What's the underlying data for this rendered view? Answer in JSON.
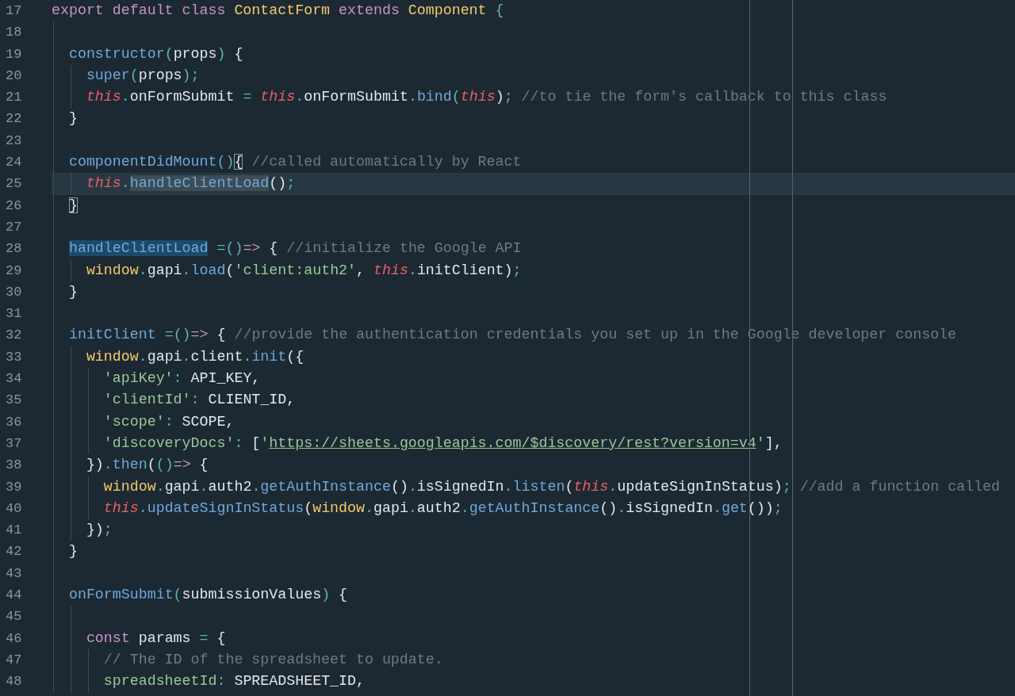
{
  "editor": {
    "lines": [
      {
        "number": "17",
        "current": false,
        "tokens": [
          {
            "kind": "keyword",
            "text": "export default class "
          },
          {
            "kind": "type",
            "text": "ContactForm"
          },
          {
            "kind": "keyword",
            "text": " extends "
          },
          {
            "kind": "type",
            "text": "Component"
          },
          {
            "kind": "punct",
            "text": " {"
          }
        ]
      },
      {
        "number": "18",
        "current": false
      },
      {
        "number": "19",
        "current": false,
        "tokens": [
          {
            "kind": "function",
            "text": "  constructor"
          },
          {
            "kind": "punct",
            "text": "("
          },
          {
            "kind": "plain",
            "text": "props"
          },
          {
            "kind": "punct",
            "text": ")"
          },
          {
            "kind": "plain",
            "text": " {"
          }
        ]
      },
      {
        "number": "20",
        "current": false,
        "tokens": [
          {
            "kind": "function",
            "text": "    super"
          },
          {
            "kind": "punct",
            "text": "("
          },
          {
            "kind": "plain",
            "text": "props"
          },
          {
            "kind": "punct",
            "text": ");"
          }
        ]
      },
      {
        "number": "21",
        "current": false,
        "tokens": [
          {
            "kind": "this",
            "text": "    this"
          },
          {
            "kind": "punct",
            "text": "."
          },
          {
            "kind": "plain",
            "text": "onFormSubmit"
          },
          {
            "kind": "punct",
            "text": " = "
          },
          {
            "kind": "this",
            "text": "this"
          },
          {
            "kind": "punct",
            "text": "."
          },
          {
            "kind": "plain",
            "text": "onFormSubmit"
          },
          {
            "kind": "punct",
            "text": "."
          },
          {
            "kind": "function",
            "text": "bind"
          },
          {
            "kind": "punct",
            "text": "("
          },
          {
            "kind": "this",
            "text": "this"
          },
          {
            "kind": "plain",
            "text": ")"
          },
          {
            "kind": "punct",
            "text": ";"
          },
          {
            "kind": "comment",
            "text": " //to tie the form's callback to this class"
          }
        ]
      },
      {
        "number": "22",
        "current": false,
        "tokens": [
          {
            "kind": "plain",
            "text": "  }"
          }
        ]
      },
      {
        "number": "23",
        "current": false
      },
      {
        "number": "24",
        "current": false,
        "tokens": [
          {
            "kind": "function",
            "text": "  componentDidMount"
          },
          {
            "kind": "punct",
            "text": "()"
          },
          {
            "kind": "plain",
            "text": "{",
            "bracket_match": true
          },
          {
            "kind": "comment",
            "text": " //called automatically by React"
          }
        ]
      },
      {
        "number": "25",
        "current": true,
        "tokens": [
          {
            "kind": "this",
            "text": "    this"
          },
          {
            "kind": "punct",
            "text": "."
          },
          {
            "kind": "function",
            "text": "handleClientLoad",
            "occurrence": true
          },
          {
            "kind": "plain",
            "text": "()"
          },
          {
            "kind": "punct",
            "text": ";"
          }
        ]
      },
      {
        "number": "26",
        "current": false,
        "tokens": [
          {
            "kind": "plain",
            "text": "  }",
            "bracket_match": true
          }
        ]
      },
      {
        "number": "27",
        "current": false
      },
      {
        "number": "28",
        "current": false,
        "tokens": [
          {
            "kind": "function",
            "text": "  handleClientLoad",
            "selected": true
          },
          {
            "kind": "punct",
            "text": " =()"
          },
          {
            "kind": "operator",
            "text": "=>"
          },
          {
            "kind": "plain",
            "text": " {"
          },
          {
            "kind": "comment",
            "text": " //initialize the Google API"
          }
        ]
      },
      {
        "number": "29",
        "current": false,
        "tokens": [
          {
            "kind": "type",
            "text": "    window"
          },
          {
            "kind": "punct",
            "text": "."
          },
          {
            "kind": "plain",
            "text": "gapi"
          },
          {
            "kind": "punct",
            "text": "."
          },
          {
            "kind": "function",
            "text": "load"
          },
          {
            "kind": "plain",
            "text": "("
          },
          {
            "kind": "string",
            "text": "'client:auth2'"
          },
          {
            "kind": "plain",
            "text": ", "
          },
          {
            "kind": "this",
            "text": "this"
          },
          {
            "kind": "punct",
            "text": "."
          },
          {
            "kind": "plain",
            "text": "initClient)"
          },
          {
            "kind": "punct",
            "text": ";"
          }
        ]
      },
      {
        "number": "30",
        "current": false,
        "tokens": [
          {
            "kind": "plain",
            "text": "  }"
          }
        ]
      },
      {
        "number": "31",
        "current": false
      },
      {
        "number": "32",
        "current": false,
        "tokens": [
          {
            "kind": "function",
            "text": "  initClient"
          },
          {
            "kind": "punct",
            "text": " =()"
          },
          {
            "kind": "operator",
            "text": "=>"
          },
          {
            "kind": "plain",
            "text": " {"
          },
          {
            "kind": "comment",
            "text": " //provide the authentication credentials you set up in the Google developer console"
          }
        ]
      },
      {
        "number": "33",
        "current": false,
        "tokens": [
          {
            "kind": "type",
            "text": "    window"
          },
          {
            "kind": "punct",
            "text": "."
          },
          {
            "kind": "plain",
            "text": "gapi"
          },
          {
            "kind": "punct",
            "text": "."
          },
          {
            "kind": "plain",
            "text": "client"
          },
          {
            "kind": "punct",
            "text": "."
          },
          {
            "kind": "function",
            "text": "init"
          },
          {
            "kind": "plain",
            "text": "({"
          }
        ]
      },
      {
        "number": "34",
        "current": false,
        "tokens": [
          {
            "kind": "string",
            "text": "      'apiKey'"
          },
          {
            "kind": "punct",
            "text": ":"
          },
          {
            "kind": "plain",
            "text": " API_KEY,"
          }
        ]
      },
      {
        "number": "35",
        "current": false,
        "tokens": [
          {
            "kind": "string",
            "text": "      'clientId'"
          },
          {
            "kind": "punct",
            "text": ":"
          },
          {
            "kind": "plain",
            "text": " CLIENT_ID,"
          }
        ]
      },
      {
        "number": "36",
        "current": false,
        "tokens": [
          {
            "kind": "string",
            "text": "      'scope'"
          },
          {
            "kind": "punct",
            "text": ":"
          },
          {
            "kind": "plain",
            "text": " SCOPE,"
          }
        ]
      },
      {
        "number": "37",
        "current": false,
        "tokens": [
          {
            "kind": "string",
            "text": "      'discoveryDocs'"
          },
          {
            "kind": "punct",
            "text": ":"
          },
          {
            "kind": "plain",
            "text": " ["
          },
          {
            "kind": "string",
            "text": "'"
          },
          {
            "kind": "url",
            "text": "https://sheets.googleapis.com/$discovery/rest?version=v4"
          },
          {
            "kind": "string",
            "text": "'"
          },
          {
            "kind": "plain",
            "text": "],"
          }
        ]
      },
      {
        "number": "38",
        "current": false,
        "tokens": [
          {
            "kind": "plain",
            "text": "    })"
          },
          {
            "kind": "punct",
            "text": "."
          },
          {
            "kind": "function",
            "text": "then"
          },
          {
            "kind": "plain",
            "text": "("
          },
          {
            "kind": "punct",
            "text": "()"
          },
          {
            "kind": "operator",
            "text": "=>"
          },
          {
            "kind": "plain",
            "text": " {"
          }
        ]
      },
      {
        "number": "39",
        "current": false,
        "tokens": [
          {
            "kind": "type",
            "text": "      window"
          },
          {
            "kind": "punct",
            "text": "."
          },
          {
            "kind": "plain",
            "text": "gapi"
          },
          {
            "kind": "punct",
            "text": "."
          },
          {
            "kind": "plain",
            "text": "auth2"
          },
          {
            "kind": "punct",
            "text": "."
          },
          {
            "kind": "function",
            "text": "getAuthInstance"
          },
          {
            "kind": "plain",
            "text": "()"
          },
          {
            "kind": "punct",
            "text": "."
          },
          {
            "kind": "plain",
            "text": "isSignedIn"
          },
          {
            "kind": "punct",
            "text": "."
          },
          {
            "kind": "function",
            "text": "listen"
          },
          {
            "kind": "plain",
            "text": "("
          },
          {
            "kind": "this",
            "text": "this"
          },
          {
            "kind": "punct",
            "text": "."
          },
          {
            "kind": "plain",
            "text": "updateSignInStatus)"
          },
          {
            "kind": "punct",
            "text": ";"
          },
          {
            "kind": "comment",
            "text": " //add a function called"
          }
        ]
      },
      {
        "number": "40",
        "current": false,
        "tokens": [
          {
            "kind": "this",
            "text": "      this"
          },
          {
            "kind": "punct",
            "text": "."
          },
          {
            "kind": "function",
            "text": "updateSignInStatus"
          },
          {
            "kind": "plain",
            "text": "("
          },
          {
            "kind": "type",
            "text": "window"
          },
          {
            "kind": "punct",
            "text": "."
          },
          {
            "kind": "plain",
            "text": "gapi"
          },
          {
            "kind": "punct",
            "text": "."
          },
          {
            "kind": "plain",
            "text": "auth2"
          },
          {
            "kind": "punct",
            "text": "."
          },
          {
            "kind": "function",
            "text": "getAuthInstance"
          },
          {
            "kind": "plain",
            "text": "()"
          },
          {
            "kind": "punct",
            "text": "."
          },
          {
            "kind": "plain",
            "text": "isSignedIn"
          },
          {
            "kind": "punct",
            "text": "."
          },
          {
            "kind": "function",
            "text": "get"
          },
          {
            "kind": "plain",
            "text": "())"
          },
          {
            "kind": "punct",
            "text": ";"
          }
        ]
      },
      {
        "number": "41",
        "current": false,
        "tokens": [
          {
            "kind": "plain",
            "text": "    })"
          },
          {
            "kind": "punct",
            "text": ";"
          }
        ]
      },
      {
        "number": "42",
        "current": false,
        "tokens": [
          {
            "kind": "plain",
            "text": "  }"
          }
        ]
      },
      {
        "number": "43",
        "current": false
      },
      {
        "number": "44",
        "current": false,
        "tokens": [
          {
            "kind": "function",
            "text": "  onFormSubmit"
          },
          {
            "kind": "punct",
            "text": "("
          },
          {
            "kind": "plain",
            "text": "submissionValues"
          },
          {
            "kind": "punct",
            "text": ")"
          },
          {
            "kind": "plain",
            "text": " {"
          }
        ]
      },
      {
        "number": "45",
        "current": false
      },
      {
        "number": "46",
        "current": false,
        "tokens": [
          {
            "kind": "keyword",
            "text": "    const"
          },
          {
            "kind": "plain",
            "text": " params "
          },
          {
            "kind": "punct",
            "text": "="
          },
          {
            "kind": "plain",
            "text": " {"
          }
        ]
      },
      {
        "number": "47",
        "current": false,
        "tokens": [
          {
            "kind": "comment",
            "text": "      // The ID of the spreadsheet to update."
          }
        ]
      },
      {
        "number": "48",
        "current": false,
        "tokens": [
          {
            "kind": "property",
            "text": "      spreadsheetId"
          },
          {
            "kind": "punct",
            "text": ":"
          },
          {
            "kind": "plain",
            "text": " SPREADSHEET_ID,"
          }
        ]
      }
    ]
  }
}
